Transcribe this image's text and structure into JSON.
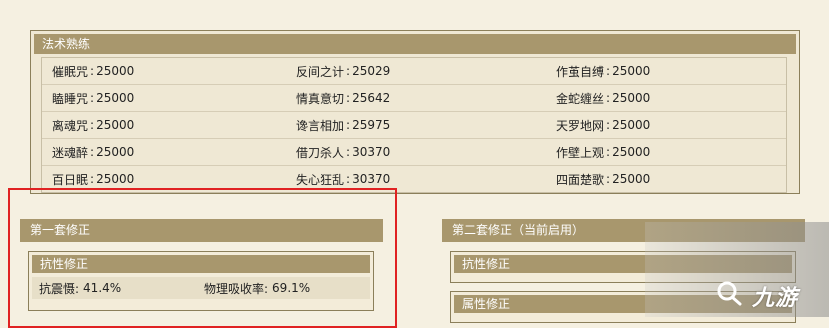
{
  "spell_panel": {
    "title": "法术熟练",
    "rows": [
      [
        {
          "name": "催眠咒",
          "value": "25000"
        },
        {
          "name": "反间之计",
          "value": "25029"
        },
        {
          "name": "作茧自缚",
          "value": "25000"
        }
      ],
      [
        {
          "name": "瞌睡咒",
          "value": "25000"
        },
        {
          "name": "情真意切",
          "value": "25642"
        },
        {
          "name": "金蛇缠丝",
          "value": "25000"
        }
      ],
      [
        {
          "name": "离魂咒",
          "value": "25000"
        },
        {
          "name": "谗言相加",
          "value": "25975"
        },
        {
          "name": "天罗地网",
          "value": "25000"
        }
      ],
      [
        {
          "name": "迷魂醉",
          "value": "25000"
        },
        {
          "name": "借刀杀人",
          "value": "30370"
        },
        {
          "name": "作壁上观",
          "value": "25000"
        }
      ],
      [
        {
          "name": "百日眠",
          "value": "25000"
        },
        {
          "name": "失心狂乱",
          "value": "30370"
        },
        {
          "name": "四面楚歌",
          "value": "25000"
        }
      ]
    ]
  },
  "first_set": {
    "title": "第一套修正",
    "resist": {
      "title": "抗性修正",
      "items": [
        {
          "label": "抗震慑:",
          "value": "41.4%"
        },
        {
          "label": "物理吸收率:",
          "value": "69.1%"
        }
      ]
    }
  },
  "second_set": {
    "title": "第二套修正（当前启用）",
    "resist_title": "抗性修正",
    "attr_title": "属性修正"
  },
  "watermark": {
    "text": "九游",
    "icon": "jiuyou-logo-icon"
  },
  "colors": {
    "header_bg": "#a8976d",
    "panel_bg": "#efe8d4",
    "highlight_box": "#e02222"
  }
}
